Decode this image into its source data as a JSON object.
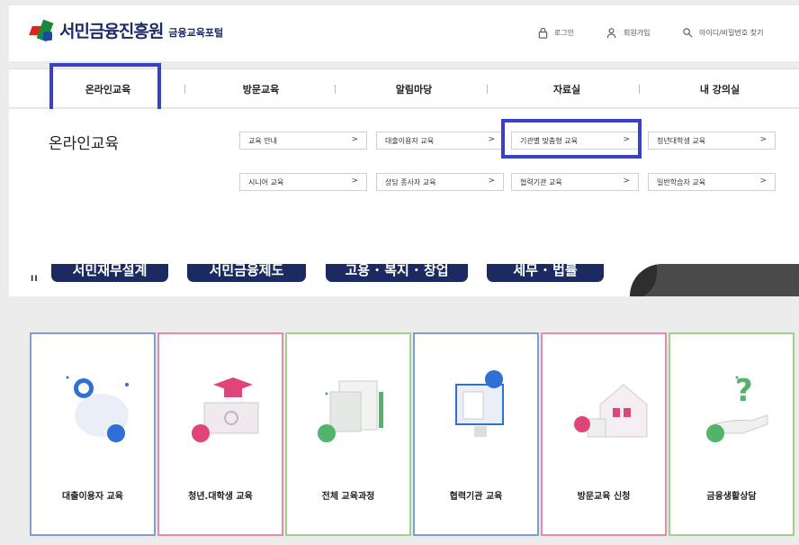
{
  "header": {
    "logo_text": "서민금융진흥원",
    "logo_sub": "금융교육포털",
    "login": "로그인",
    "signup": "회원가입",
    "find_account": "아이디/비밀번호 찾기"
  },
  "nav": {
    "items": [
      {
        "label": "온라인교육",
        "highlighted": true
      },
      {
        "label": "방문교육"
      },
      {
        "label": "알림마당"
      },
      {
        "label": "자료실"
      },
      {
        "label": "내 강의실"
      }
    ]
  },
  "submenu": {
    "title": "온라인교육",
    "links": [
      {
        "label": "교육 안내"
      },
      {
        "label": "대출이용자 교육"
      },
      {
        "label": "기관별 맞춤형 교육",
        "highlighted": true
      },
      {
        "label": "청년대학생 교육"
      },
      {
        "label": "시니어 교육"
      },
      {
        "label": "상담 종사자 교육"
      },
      {
        "label": "협력기관 교육"
      },
      {
        "label": "일반학습자 교육"
      }
    ],
    "arrow": ">"
  },
  "banner": {
    "pause": "II",
    "pills": [
      "서민재무설계",
      "서민금융제도",
      "고용 · 복지 · 창업",
      "세무 · 법률"
    ]
  },
  "cards": [
    {
      "label": "대출이용자 교육",
      "border": "#7b9fd6"
    },
    {
      "label": "청년.대학생 교육",
      "border": "#e98aa6"
    },
    {
      "label": "전체 교육과정",
      "border": "#9fd18c"
    },
    {
      "label": "협력기관 교육",
      "border": "#7b9fd6"
    },
    {
      "label": "방문교육 신청",
      "border": "#e98aa6"
    },
    {
      "label": "금융생활상담",
      "border": "#9fd18c"
    }
  ],
  "colors": {
    "highlight": "#3a40c8",
    "navy": "#1b2a60",
    "accent_blue": "#2f6fd6",
    "accent_pink": "#e0457a",
    "accent_green": "#52b36a"
  }
}
